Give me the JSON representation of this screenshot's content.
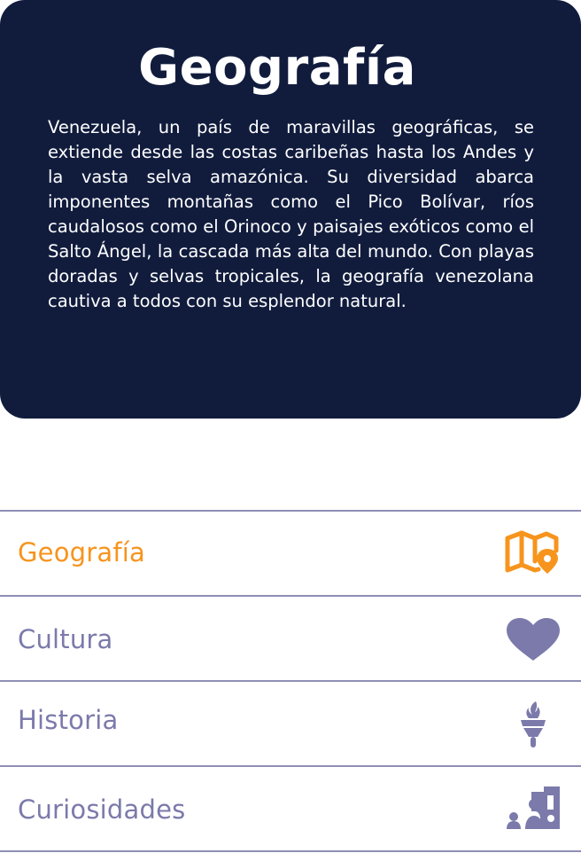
{
  "card": {
    "title": "Geografía",
    "text": "Venezuela, un país de maravillas geográficas, se extiende desde las costas caribeñas hasta los Andes y la vasta selva amazónica. Su diversidad abarca imponentes montañas como el Pico Bolívar, ríos caudalosos como el Orinoco y paisajes exóticos como el Salto Ángel, la cascada más alta del mundo. Con playas doradas y selvas tropicales, la geografía venezolana cautiva a todos con su esplendor natural."
  },
  "menu": {
    "items": [
      {
        "label": "Geografía",
        "icon": "map-pin-icon",
        "active": true
      },
      {
        "label": "Cultura",
        "icon": "heart-icon",
        "active": false
      },
      {
        "label": "Historia",
        "icon": "torch-icon",
        "active": false
      },
      {
        "label": "Curiosidades",
        "icon": "people-curiosities-icon",
        "active": false
      }
    ]
  },
  "colors": {
    "card_background": "#111c3d",
    "active": "#f7941d",
    "inactive": "#7b7aab",
    "divider": "#8e8fb5"
  }
}
